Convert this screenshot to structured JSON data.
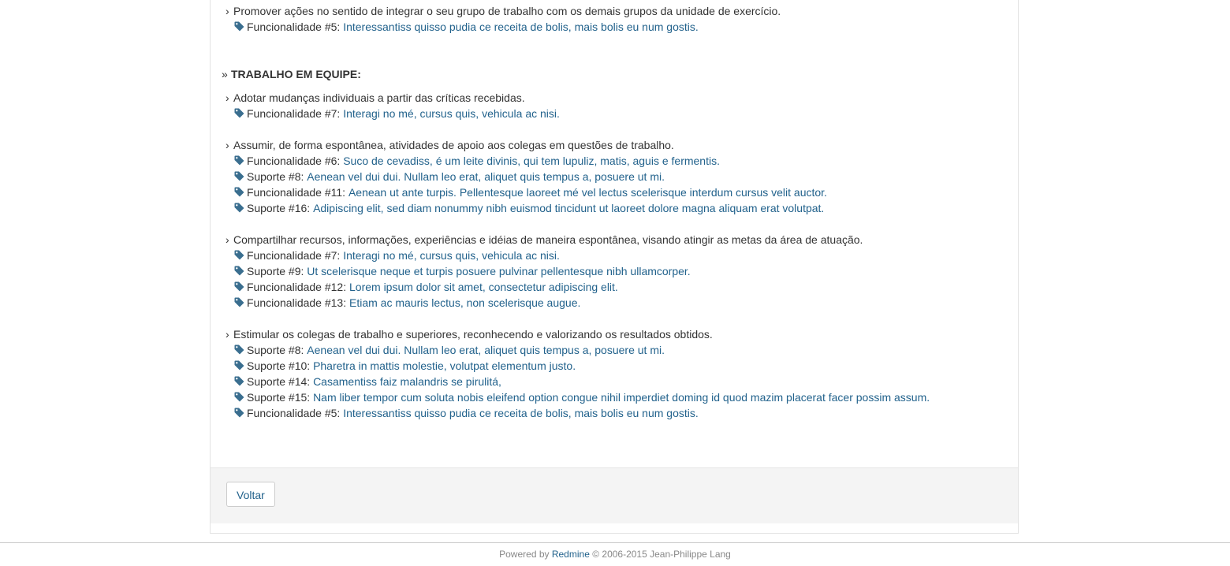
{
  "colors": {
    "link": "#22628c",
    "text": "#333333",
    "icon": "#3a6e8f"
  },
  "top_block": {
    "criterion": "Promover ações no sentido de integrar o seu grupo de trabalho com os demais grupos da unidade de exercício.",
    "refs": [
      {
        "label": "Funcionalidade #5:",
        "link": "Interessantiss quisso pudia ce receita de bolis, mais bolis eu num gostis."
      }
    ]
  },
  "section": {
    "title": "TRABALHO EM EQUIPE:",
    "criteria": [
      {
        "text": "Adotar mudanças individuais a partir das críticas recebidas.",
        "refs": [
          {
            "label": "Funcionalidade #7:",
            "link": "Interagi no mé, cursus quis, vehicula ac nisi."
          }
        ]
      },
      {
        "text": "Assumir, de forma espontânea, atividades de apoio aos colegas em questões de trabalho.",
        "refs": [
          {
            "label": "Funcionalidade #6:",
            "link": "Suco de cevadiss, é um leite divinis, qui tem lupuliz, matis, aguis e fermentis."
          },
          {
            "label": "Suporte #8:",
            "link": "Aenean vel dui dui. Nullam leo erat, aliquet quis tempus a, posuere ut mi."
          },
          {
            "label": "Funcionalidade #11:",
            "link": "Aenean ut ante turpis. Pellentesque laoreet mé vel lectus scelerisque interdum cursus velit auctor."
          },
          {
            "label": "Suporte #16:",
            "link": "Adipiscing elit, sed diam nonummy nibh euismod tincidunt ut laoreet dolore magna aliquam erat volutpat."
          }
        ]
      },
      {
        "text": "Compartilhar recursos, informações, experiências e idéias de maneira espontânea, visando atingir as metas da área de atuação.",
        "refs": [
          {
            "label": "Funcionalidade #7:",
            "link": "Interagi no mé, cursus quis, vehicula ac nisi."
          },
          {
            "label": "Suporte #9:",
            "link": "Ut scelerisque neque et turpis posuere pulvinar pellentesque nibh ullamcorper."
          },
          {
            "label": "Funcionalidade #12:",
            "link": "Lorem ipsum dolor sit amet, consectetur adipiscing elit."
          },
          {
            "label": "Funcionalidade #13:",
            "link": "Etiam ac mauris lectus, non scelerisque augue."
          }
        ]
      },
      {
        "text": "Estimular os colegas de trabalho e superiores, reconhecendo e valorizando os resultados obtidos.",
        "refs": [
          {
            "label": "Suporte #8:",
            "link": "Aenean vel dui dui. Nullam leo erat, aliquet quis tempus a, posuere ut mi."
          },
          {
            "label": "Suporte #10:",
            "link": "Pharetra in mattis molestie, volutpat elementum justo."
          },
          {
            "label": "Suporte #14:",
            "link": "Casamentiss faiz malandris se pirulitá,"
          },
          {
            "label": "Suporte #15:",
            "link": "Nam liber tempor cum soluta nobis eleifend option congue nihil imperdiet doming id quod mazim placerat facer possim assum."
          },
          {
            "label": "Funcionalidade #5:",
            "link": "Interessantiss quisso pudia ce receita de bolis, mais bolis eu num gostis."
          }
        ]
      }
    ]
  },
  "actions": {
    "back_label": "Voltar"
  },
  "footer": {
    "prefix": "Powered by",
    "link": "Redmine",
    "suffix": "© 2006-2015 Jean-Philippe Lang"
  }
}
